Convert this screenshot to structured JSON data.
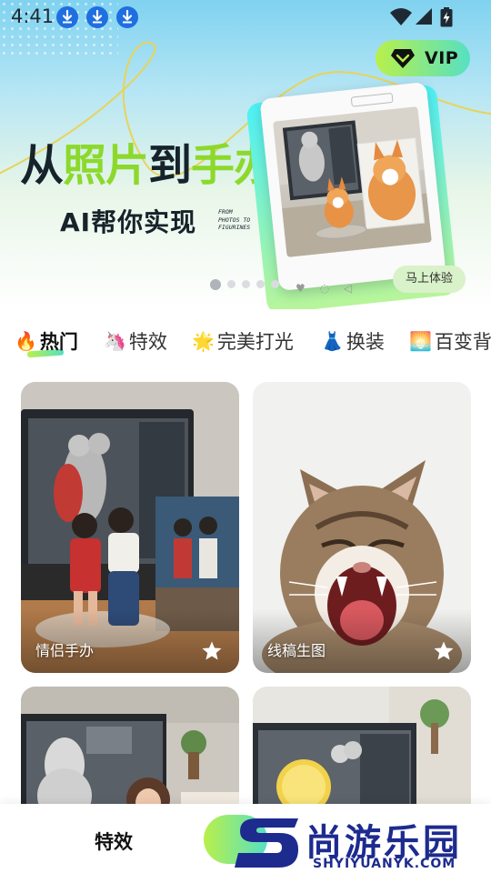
{
  "status_bar": {
    "time": "4:41",
    "icons": [
      "download-icon",
      "download-icon",
      "download-icon",
      "wifi-icon",
      "cell-signal-icon",
      "battery-charging-icon"
    ]
  },
  "vip": {
    "label": "VIP",
    "icon": "diamond-icon"
  },
  "banner": {
    "headline_part1": "从",
    "headline_part2": "照片",
    "headline_part3": "到",
    "headline_part4": "手办",
    "subline": "AI帮你实现",
    "caption_lines": [
      "FROM",
      "PHOTOS TO",
      "FIGURINES"
    ],
    "try_button": "马上体验",
    "page_count": 5,
    "active_page": 1
  },
  "tabs": [
    {
      "emoji": "🔥",
      "label": "热门",
      "active": true
    },
    {
      "emoji": "🦄",
      "label": "特效",
      "active": false
    },
    {
      "emoji": "🌟",
      "label": "完美打光",
      "active": false
    },
    {
      "emoji": "👗",
      "label": "换装",
      "active": false
    },
    {
      "emoji": "🌅",
      "label": "百变背",
      "active": false
    }
  ],
  "cards": [
    {
      "label": "情侣手办",
      "icon": "star-icon"
    },
    {
      "label": "线稿生图",
      "icon": "star-icon"
    },
    {
      "label": "",
      "icon": ""
    },
    {
      "label": "",
      "icon": ""
    }
  ],
  "bottom_nav": {
    "effects_label": "特效"
  },
  "watermark": {
    "brand": "尚游乐园",
    "url": "SHYIYUANYK.COM"
  },
  "colors": {
    "accent_start": "#b9f04a",
    "accent_end": "#56e0c3",
    "headline_green": "#8cd92b",
    "download_blue": "#1f6fe0",
    "watermark_blue": "#1d2b8f"
  }
}
